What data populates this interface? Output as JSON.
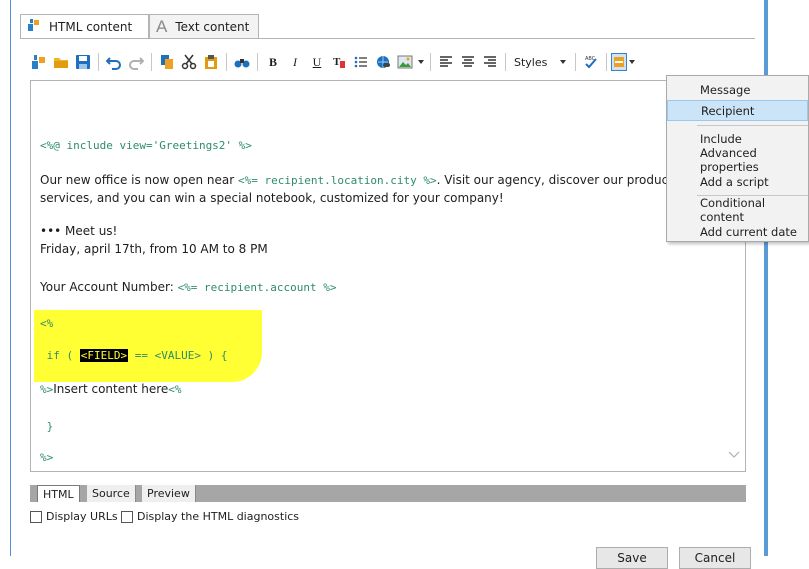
{
  "tabs": [
    {
      "label": "HTML content",
      "icon": "html-content-icon",
      "active": true
    },
    {
      "label": "Text content",
      "icon": "text-content-icon",
      "active": false
    }
  ],
  "toolbar": {
    "styles_label": "Styles"
  },
  "editor": {
    "lines": {
      "include": "<%@ include view='Greetings2' %>",
      "p1_a": "Our new office is now open near ",
      "p1_code": "<%= recipient.location.city %>",
      "p1_b": ". Visit our agency, discover our products",
      "p2": "services, and you can win a special notebook, customized for your company!",
      "meet": "••• Meet us!",
      "date": "Friday, april 17th, from 10 AM to 8 PM",
      "account_label": "Your Account Number: ",
      "account_code": "<%= recipient.account %>",
      "open_tag": "<%",
      "if_a": " if ( ",
      "if_field": "<FIELD>",
      "if_b": " == <VALUE> ) {",
      "insert_a": "%>",
      "insert_text": "Insert content here",
      "insert_b": "<%",
      "close_brace": " }",
      "close_tag": "%>"
    }
  },
  "bottom_tabs": [
    {
      "label": "HTML",
      "active": true
    },
    {
      "label": "Source",
      "active": false
    },
    {
      "label": "Preview",
      "active": false
    }
  ],
  "checkboxes": [
    {
      "label": "Display URLs",
      "checked": false
    },
    {
      "label": "Display the HTML diagnostics",
      "checked": false
    }
  ],
  "buttons": {
    "save": "Save",
    "cancel": "Cancel"
  },
  "menu": {
    "items": [
      {
        "label": "Message",
        "selected": false
      },
      {
        "label": "Recipient",
        "selected": true
      },
      {
        "label": "Include",
        "selected": false
      },
      {
        "label": "Advanced properties",
        "selected": false
      },
      {
        "label": "Add a script",
        "selected": false
      },
      {
        "label": "Conditional content",
        "selected": false
      },
      {
        "label": "Add current date",
        "selected": false
      }
    ]
  },
  "colors": {
    "code": "#2e8b6e",
    "highlight": "#ffff33",
    "accent": "#5b9bd5"
  }
}
